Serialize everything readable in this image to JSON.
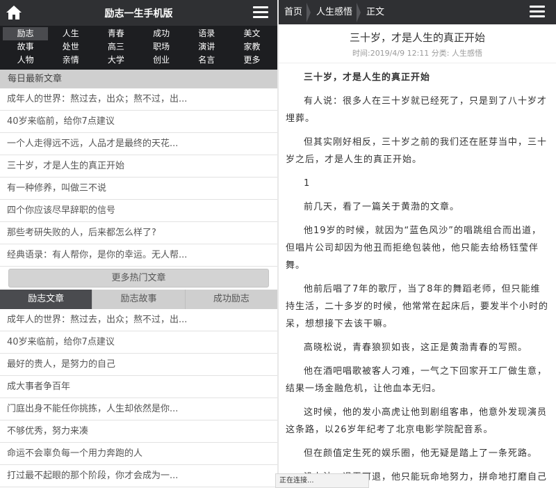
{
  "left": {
    "header": {
      "title": "励志一生手机版"
    },
    "categories": [
      [
        "励志",
        "人生",
        "青春",
        "成功",
        "语录",
        "美文"
      ],
      [
        "故事",
        "处世",
        "高三",
        "职场",
        "演讲",
        "家教"
      ],
      [
        "人物",
        "亲情",
        "大学",
        "创业",
        "名言",
        "更多"
      ]
    ],
    "latest": {
      "title": "每日最新文章",
      "items": [
        "成年人的世界：熬过去，出众；熬不过，出...",
        "40岁来临前，给你7点建议",
        "一个人走得远不远，人品才是最终的天花...",
        "三十岁，才是人生的真正开始",
        "有一种修养，叫做三不说",
        "四个你应该尽早辞职的信号",
        "那些考研失败的人，后来都怎么样了?",
        "经典语录：有人帮你，是你的幸运。无人帮..."
      ]
    },
    "more_label": "更多热门文章",
    "tabs": [
      "励志文章",
      "励志故事",
      "成功励志"
    ],
    "tab_items": [
      "成年人的世界：熬过去，出众；熬不过，出...",
      "40岁来临前，给你7点建议",
      "最好的贵人，是努力的自己",
      "成大事者争百年",
      "门庭出身不能任你挑拣，人生却依然是你...",
      "不够优秀，努力来凑",
      "命运不会辜负每一个用力奔跑的人",
      "打过最不起眼的那个阶段，你才会成为一..."
    ]
  },
  "right": {
    "breadcrumb": [
      "首页",
      "人生感悟",
      "正文"
    ],
    "article": {
      "title": "三十岁，才是人生的真正开始",
      "meta": "时间:2019/4/9 12:11 分类: 人生感悟",
      "paragraphs": [
        "三十岁，才是人生的真正开始",
        "有人说：很多人在三十岁就已经死了，只是到了八十岁才埋葬。",
        "但其实刚好相反，三十岁之前的我们还在胚芽当中，三十岁之后，才是人生的真正开始。",
        "1",
        "前几天，看了一篇关于黄渤的文章。",
        "他19岁的时候，就因为“蓝色风沙”的唱跳组合而出道，但唱片公司却因为他丑而拒绝包装他，他只能去给杨钰莹伴舞。",
        "他前后唱了7年的歌厅，当了8年的舞蹈老师，但只能维持生活，二十多岁的时候，他常常在起床后，要发半个小时的呆，想想接下去该干嘛。",
        "高晓松说，青春狼狈如丧，这正是黄渤青春的写照。",
        "他在酒吧唱歌被客人刁难，一气之下回家开工厂做生意，结果一场金融危机，让他血本无归。",
        "这时候，他的发小高虎让他到剧组客串，他意外发现演员这条路，以26岁年纪考了北京电影学院配音系。",
        "但在颜值定生死的娱乐圈，他无疑是踏上了一条死路。",
        "没办法，退无可退，他只能玩命地努力，拼命地打磨自己的演技。"
      ]
    }
  },
  "status_text": "正在连接..."
}
